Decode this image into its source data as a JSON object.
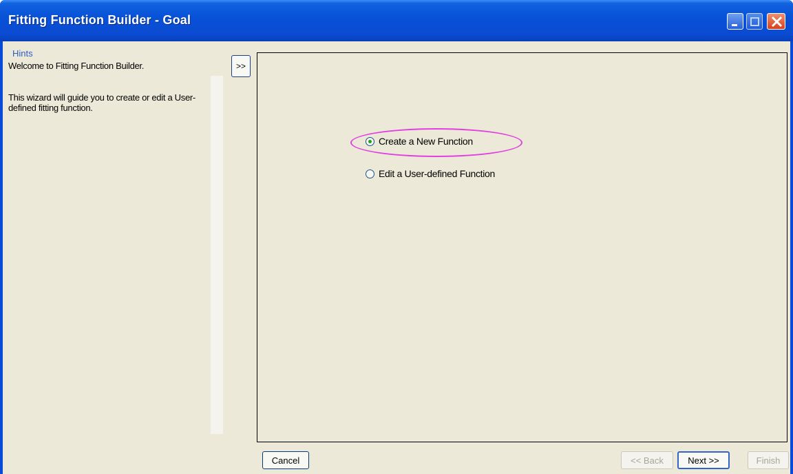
{
  "window": {
    "title": "Fitting Function Builder - Goal",
    "controls": [
      "minimize-icon",
      "maximize-icon",
      "close-icon"
    ]
  },
  "hints": {
    "label": "Hints",
    "paragraph1": "Welcome to Fitting Function Builder.",
    "paragraph2": "This wizard will guide you to create or edit a User-defined fitting function."
  },
  "toggle_button": {
    "label": ">>"
  },
  "options": [
    {
      "label": "Create a New Function",
      "selected": true
    },
    {
      "label": "Edit a User-defined Function",
      "selected": false
    }
  ],
  "buttons": {
    "cancel": "Cancel",
    "back": "<< Back",
    "next": "Next >>",
    "finish": "Finish"
  },
  "colors": {
    "titlebar": "#0a4ad8",
    "client_bg": "#ece9d8",
    "highlight": "#e040e0",
    "hints_label": "#2a5cc8"
  }
}
